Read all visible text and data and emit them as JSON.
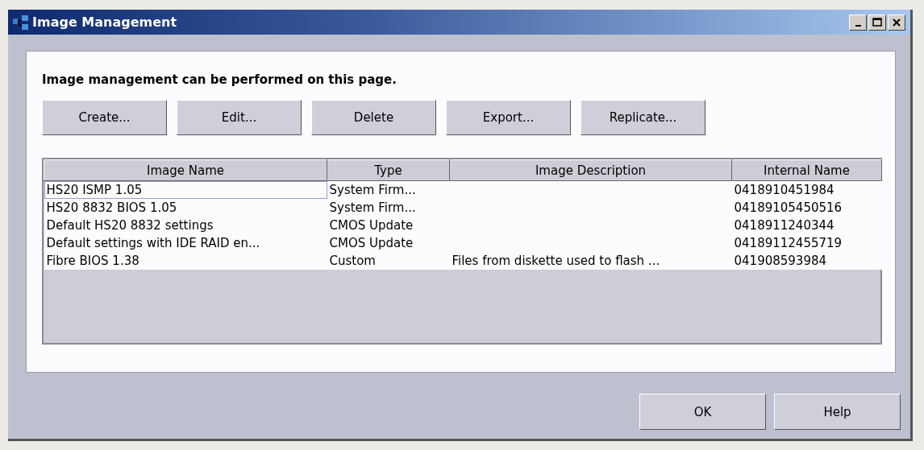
{
  "window": {
    "title": "Image Management"
  },
  "intro": "Image management can be performed on this page.",
  "actions": [
    {
      "label": "Create..."
    },
    {
      "label": "Edit..."
    },
    {
      "label": "Delete"
    },
    {
      "label": "Export..."
    },
    {
      "label": "Replicate..."
    }
  ],
  "table": {
    "columns": [
      "Image Name",
      "Type",
      "Image Description",
      "Internal Name"
    ],
    "rows": [
      {
        "cells": [
          "HS20 ISMP 1.05",
          "System Firm...",
          "",
          "0418910451984"
        ],
        "selected": true
      },
      {
        "cells": [
          "HS20 8832 BIOS 1.05",
          "System Firm...",
          "",
          "04189105450516"
        ],
        "selected": false
      },
      {
        "cells": [
          "Default HS20 8832 settings",
          "CMOS Update",
          "",
          "0418911240344"
        ],
        "selected": false
      },
      {
        "cells": [
          "Default settings with IDE RAID en...",
          "CMOS Update",
          "",
          "04189112455719"
        ],
        "selected": false
      },
      {
        "cells": [
          "Fibre BIOS 1.38",
          "Custom",
          "Files from diskette used to flash ...",
          "041908593984"
        ],
        "selected": false
      }
    ]
  },
  "dialog_buttons": [
    {
      "label": "OK"
    },
    {
      "label": "Help"
    }
  ]
}
